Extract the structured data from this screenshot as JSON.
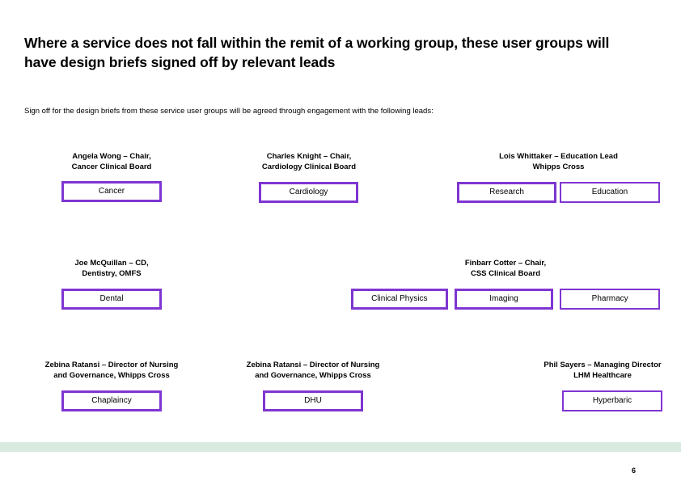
{
  "slide": {
    "title": "Where a service does not fall within the remit of a working group, these user groups will have design briefs signed off by relevant leads",
    "subtitle": "Sign off for the design briefs from these service user groups will be agreed through engagement with the following leads:",
    "page_number": "6",
    "accent_color": "#7F35D1",
    "footer_band_color": "#D9EAE0",
    "background_color": "#FFFFFF"
  },
  "groups": [
    {
      "id": "cancer",
      "lead_line1": "Angela Wong – Chair,",
      "lead_line2": "Cancer Clinical Board",
      "boxes": [
        {
          "label": "Cancer"
        }
      ]
    },
    {
      "id": "cardiology",
      "lead_line1": "Charles Knight – Chair,",
      "lead_line2": "Cardiology Clinical Board",
      "boxes": [
        {
          "label": "Cardiology"
        }
      ]
    },
    {
      "id": "education",
      "lead_line1": "Lois Whittaker – Education Lead",
      "lead_line2": "Whipps Cross",
      "boxes": [
        {
          "label": "Research"
        },
        {
          "label": "Education"
        }
      ]
    },
    {
      "id": "dental",
      "lead_line1": "Joe McQuillan – CD,",
      "lead_line2": "Dentistry, OMFS",
      "boxes": [
        {
          "label": "Dental"
        }
      ]
    },
    {
      "id": "css",
      "lead_line1": "Finbarr Cotter – Chair,",
      "lead_line2": "CSS Clinical Board",
      "boxes": [
        {
          "label": "Clinical Physics"
        },
        {
          "label": "Imaging"
        },
        {
          "label": "Pharmacy"
        }
      ]
    },
    {
      "id": "chaplaincy",
      "lead_line1": "Zebina Ratansi – Director of Nursing",
      "lead_line2": "and Governance, Whipps Cross",
      "boxes": [
        {
          "label": "Chaplaincy"
        }
      ]
    },
    {
      "id": "dhu",
      "lead_line1": "Zebina Ratansi – Director of Nursing",
      "lead_line2": "and Governance, Whipps Cross",
      "boxes": [
        {
          "label": "DHU"
        }
      ]
    },
    {
      "id": "hyperbaric",
      "lead_line1": "Phil Sayers – Managing Director",
      "lead_line2": "LHM Healthcare",
      "boxes": [
        {
          "label": "Hyperbaric"
        }
      ]
    }
  ]
}
